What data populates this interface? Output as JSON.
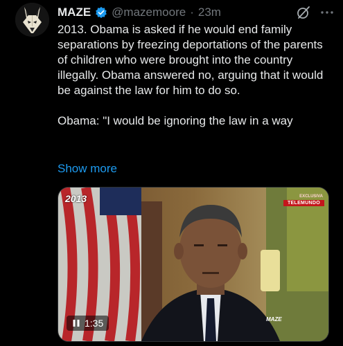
{
  "author": {
    "display_name": "MAZE",
    "handle": "@mazemoore",
    "separator": "·",
    "time": "23m"
  },
  "tweet": {
    "paragraph_1": "2013. Obama is asked if he would end family separations by freezing deportations of the parents of children who were brought into the country illegally. Obama answered no, arguing that it would be against the law for him to do so.",
    "paragraph_2": "Obama: \"I would be ignoring the law in a way",
    "show_more": "Show more"
  },
  "media": {
    "year_badge": "2013",
    "exclusive_label": "EXCLUSIVA",
    "network_label": "TELEMUNDO",
    "watermark": "MAZE",
    "duration": "1:35",
    "state": "playing"
  },
  "colors": {
    "background": "#000000",
    "text": "#e7e9ea",
    "muted": "#71767b",
    "link": "#1d9bf0",
    "verified": "#1d9bf0",
    "network_red": "#c4161c"
  },
  "icons": {
    "verified": "verified-badge-icon",
    "grok": "grok-icon",
    "more": "more-icon",
    "pause": "pause-icon"
  }
}
